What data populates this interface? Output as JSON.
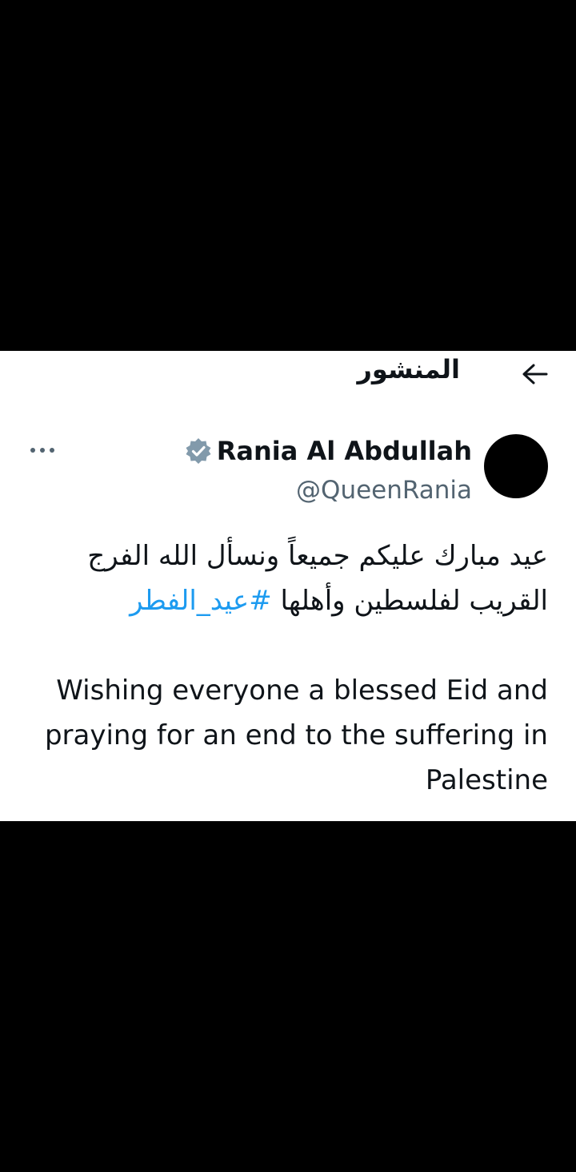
{
  "header": {
    "title": "المنشور",
    "back_icon": "arrow-back-icon"
  },
  "author": {
    "display_name": "Rania Al Abdullah",
    "handle": "@QueenRania",
    "verified_icon": "verified-badge-icon",
    "verified_color": "#829aab",
    "avatar_color": "#000000"
  },
  "more_label": "•••",
  "tweet": {
    "arabic_text": "عيد مبارك عليكم جميعاً ونسأل الله الفرج القريب لفلسطين وأهلها ",
    "hashtag": "#عيد_الفطر",
    "english_text": "Wishing everyone a blessed Eid and praying for an end to the suffering in Palestine"
  },
  "colors": {
    "link": "#1d9bf0",
    "text": "#0f1419",
    "secondary": "#536471",
    "background": "#ffffff",
    "frame": "#000000"
  }
}
